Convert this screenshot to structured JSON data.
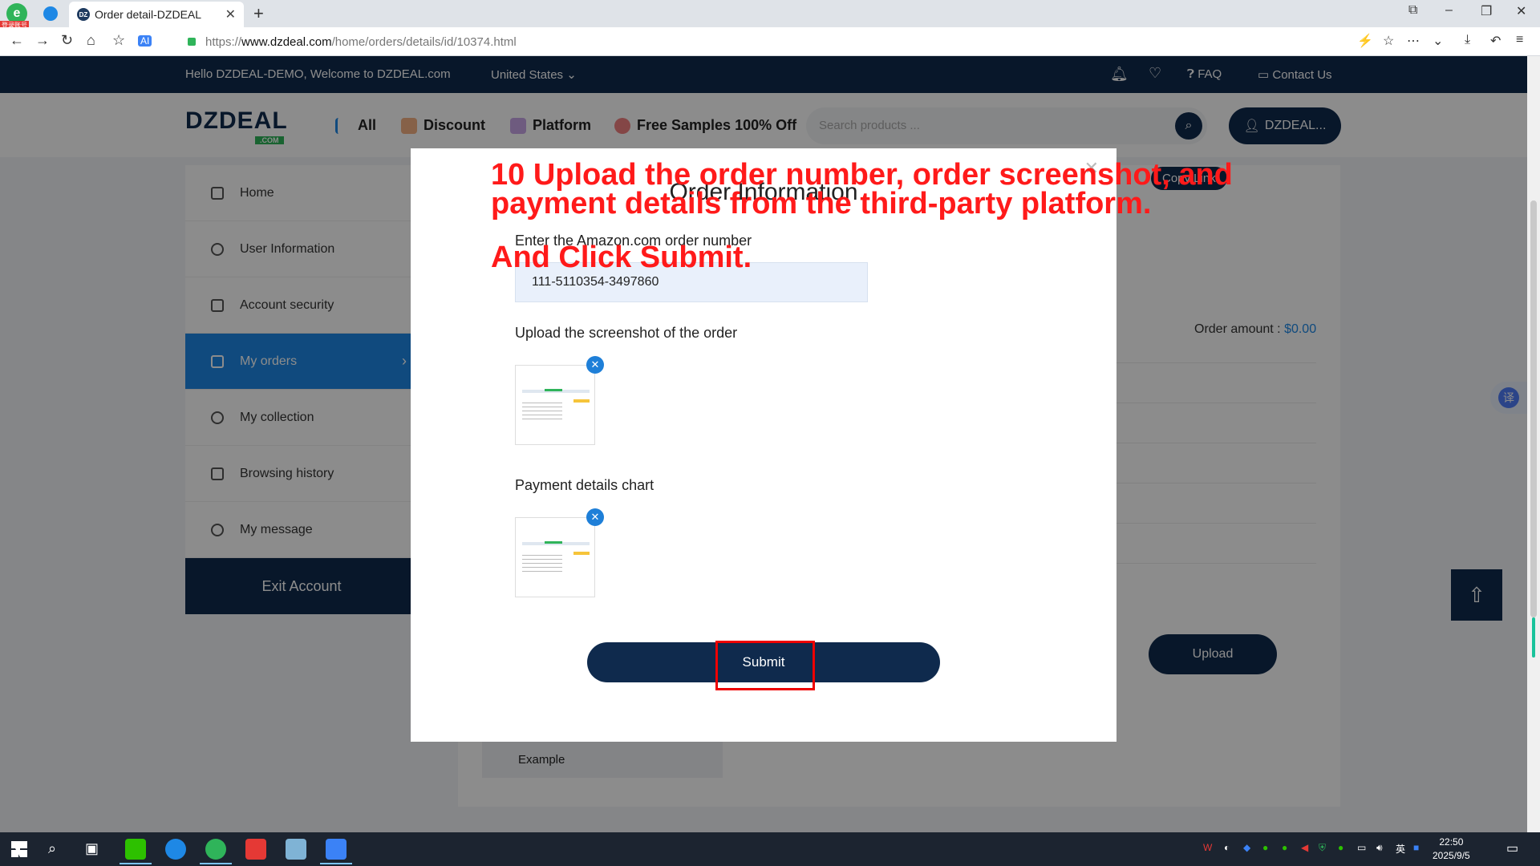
{
  "browser": {
    "tab_title": "Order detail-DZDEAL",
    "url_scheme": "https://",
    "url_host": "www.dzdeal.com",
    "url_path": "/home/orders/details/id/10374.html",
    "badge": "登录账号"
  },
  "topstrip": {
    "greeting": "Hello DZDEAL-DEMO, Welcome to DZDEAL.com",
    "country": "United States",
    "faq": "FAQ",
    "contact": "Contact Us"
  },
  "header": {
    "logo": "DZDEAL",
    "logo_sub": ".COM",
    "nav": [
      "All",
      "Discount",
      "Platform",
      "Free Samples 100% Off"
    ],
    "search_placeholder": "Search products ...",
    "user_label": "DZDEAL..."
  },
  "sidebar": {
    "items": [
      {
        "label": "Home",
        "icon": "home-icon"
      },
      {
        "label": "User Information",
        "icon": "user-icon"
      },
      {
        "label": "Account security",
        "icon": "lock-icon"
      },
      {
        "label": "My orders",
        "icon": "orders-icon"
      },
      {
        "label": "My collection",
        "icon": "heart-icon"
      },
      {
        "label": "Browsing history",
        "icon": "flag-icon"
      },
      {
        "label": "My message",
        "icon": "message-icon"
      }
    ],
    "exit": "Exit Account"
  },
  "content": {
    "copy_link": "Copy Link",
    "order_amount_label": "Order amount :",
    "order_amount_value": "$0.00",
    "upload": "Upload",
    "example": "Example"
  },
  "modal": {
    "title": "Order Information",
    "order_number_label": "Enter the Amazon.com order number",
    "order_number_value": "111-5110354-3497860",
    "screenshot_label": "Upload the screenshot of the order",
    "payment_label": "Payment details chart",
    "submit": "Submit"
  },
  "annotation": {
    "line1": "10 Upload the order number, order screenshot, and payment details from the third-party platform.",
    "line2": "And Click Submit."
  },
  "taskbar": {
    "time": "22:50",
    "date": "2025/9/5",
    "ime": "英"
  },
  "colors": {
    "navy": "#0f2a4d",
    "accent_blue": "#1e88e5",
    "annotation_red": "#ff1a1a"
  }
}
